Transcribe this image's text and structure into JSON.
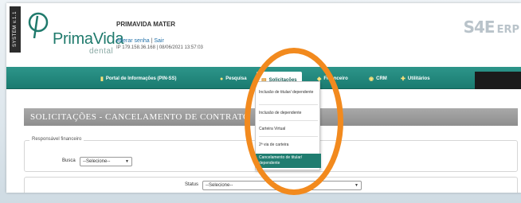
{
  "header": {
    "side_tag": "SYSTEM v.1.1",
    "logo_name": "PrimaVida",
    "logo_sub": "dental",
    "user_name": "PRIMAVIDA MATER",
    "link_change_password": "Alterar senha",
    "link_separator": "|",
    "link_logout": "Sair",
    "ip_info": "IP 179.158.36.168 | 08/06/2021 13:57:03",
    "brand": "S4E",
    "brand_suffix": "ERP"
  },
  "nav": {
    "items": [
      {
        "label": "Portal de Informações (PIN-SS)",
        "icon": "chart-icon"
      },
      {
        "label": "Pesquisa",
        "icon": "search-icon"
      },
      {
        "label": "Solicitações",
        "icon": "doc-icon"
      },
      {
        "label": "Financeiro",
        "icon": "money-icon"
      },
      {
        "label": "CRM",
        "icon": "crm-icon"
      },
      {
        "label": "Utilitários",
        "icon": "tools-icon"
      }
    ]
  },
  "dropdown": {
    "items": [
      "Inclusão de titular/ dependente",
      "Inclusão de dependente",
      "Carteira Virtual",
      "2ª via de carteira",
      "Cancelamento de titular/ dependente"
    ],
    "selected_index": 4
  },
  "main": {
    "page_title": "SOLICITAÇÕES - CANCELAMENTO DE CONTRATO",
    "responsavel_legend": "Responsável financeiro",
    "busca_label": "Busca",
    "busca_value": "--Selecione--",
    "status_label": "Status",
    "status_value": "--Selecione--"
  },
  "colors": {
    "nav_green": "#1a7b70",
    "accent_orange": "#f28a1e",
    "title_gray": "#8e8e8e"
  }
}
